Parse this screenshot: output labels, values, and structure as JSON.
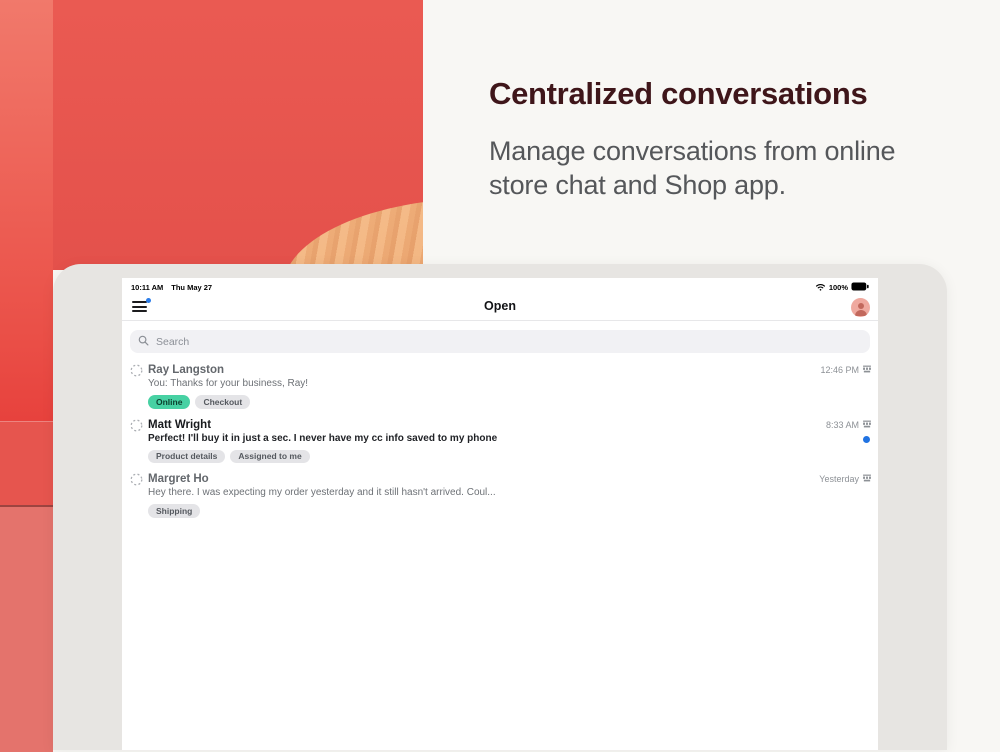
{
  "hero": {
    "title": "Centralized conversations",
    "subtitle": "Manage conversations from online store chat and Shop app."
  },
  "device": {
    "status": {
      "time": "10:11 AM",
      "date": "Thu May 27",
      "battery": "100%"
    },
    "nav": {
      "title": "Open"
    },
    "search": {
      "placeholder": "Search"
    },
    "conversations": [
      {
        "name": "Ray Langston",
        "preview": "You: Thanks for your business, Ray!",
        "timestamp": "12:46 PM",
        "unread": false,
        "tags": [
          {
            "label": "Online",
            "variant": "green"
          },
          {
            "label": "Checkout",
            "variant": "gray"
          }
        ]
      },
      {
        "name": "Matt Wright",
        "preview": "Perfect! I'll buy it in just a sec. I never have my cc info saved to my phone",
        "timestamp": "8:33 AM",
        "unread": true,
        "tags": [
          {
            "label": "Product details",
            "variant": "gray"
          },
          {
            "label": "Assigned to me",
            "variant": "gray"
          }
        ]
      },
      {
        "name": "Margret Ho",
        "preview": "Hey there. I was expecting my order yesterday and it still hasn't arrived. Coul...",
        "timestamp": "Yesterday",
        "unread": false,
        "tags": [
          {
            "label": "Shipping",
            "variant": "gray"
          }
        ]
      }
    ]
  },
  "icons": {
    "menu": "hamburger-menu-icon",
    "avatar": "user-avatar",
    "wifi": "wifi-icon",
    "battery": "battery-icon",
    "search": "search-icon",
    "channel": "dashed-circle-icon",
    "timestamp_channel": "storefront-icon",
    "unread": "unread-dot"
  },
  "colors": {
    "brand_red": "#e85750",
    "title_maroon": "#3f161a",
    "online_tag_green": "#47d1a3",
    "unread_blue": "#2173e2",
    "badge_blue": "#2b7de9"
  }
}
